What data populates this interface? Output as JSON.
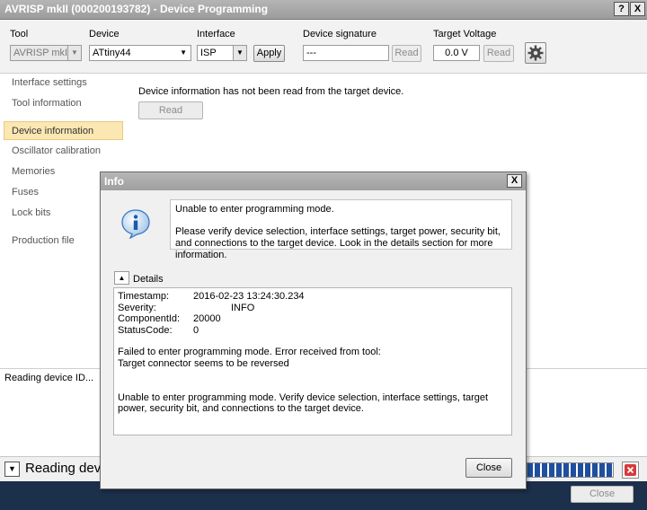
{
  "window": {
    "title": "AVRISP mkII (000200193782) - Device Programming",
    "help_btn": "?",
    "close_btn": "X"
  },
  "toolbar": {
    "tool_label": "Tool",
    "tool_value": "AVRISP mkII",
    "device_label": "Device",
    "device_value": "ATtiny44",
    "interface_label": "Interface",
    "interface_value": "ISP",
    "apply_label": "Apply",
    "signature_label": "Device signature",
    "signature_value": "---",
    "signature_read": "Read",
    "voltage_label": "Target Voltage",
    "voltage_value": "0.0 V",
    "voltage_read": "Read"
  },
  "sidebar": {
    "items": [
      {
        "label": "Interface settings"
      },
      {
        "label": "Tool information"
      },
      {
        "label": "Device information"
      },
      {
        "label": "Oscillator calibration"
      },
      {
        "label": "Memories"
      },
      {
        "label": "Fuses"
      },
      {
        "label": "Lock bits"
      },
      {
        "label": "Production file"
      }
    ]
  },
  "main": {
    "message": "Device information has not been read from the target device.",
    "read_button": "Read"
  },
  "log": {
    "line1": "Reading device ID..."
  },
  "status": {
    "text": "Reading devic"
  },
  "footer": {
    "close_button": "Close"
  },
  "dialog": {
    "title": "Info",
    "close_x": "X",
    "message_title": "Unable to enter programming mode.",
    "message_body": "Please verify device selection, interface settings, target power, security bit, and connections to the target device. Look in the details section for more information.",
    "details_label": "Details",
    "details": {
      "timestamp_key": "Timestamp:",
      "timestamp_val": "2016-02-23 13:24:30.234",
      "severity_key": "Severity:",
      "severity_val": "INFO",
      "componentid_key": "ComponentId:",
      "componentid_val": "20000",
      "statuscode_key": "StatusCode:",
      "statuscode_val": "0",
      "error_line1": "Failed to enter programming mode. Error received from tool:",
      "error_line2": "Target connector seems to be reversed",
      "summary": "Unable to enter programming mode. Verify device selection, interface settings, target power, security bit, and connections to the target device."
    },
    "close_button": "Close"
  },
  "colors": {
    "title_bar": "#a7a7a7",
    "selected_nav": "#fbe7b2",
    "progress": "#1f4f9e",
    "bottom_bar": "#1c2f4b"
  },
  "icons": {
    "settings": "gear-icon",
    "info": "info-icon",
    "stop": "stop-icon",
    "expand": "chevron-down-icon",
    "collapse": "chevron-up-icon"
  }
}
